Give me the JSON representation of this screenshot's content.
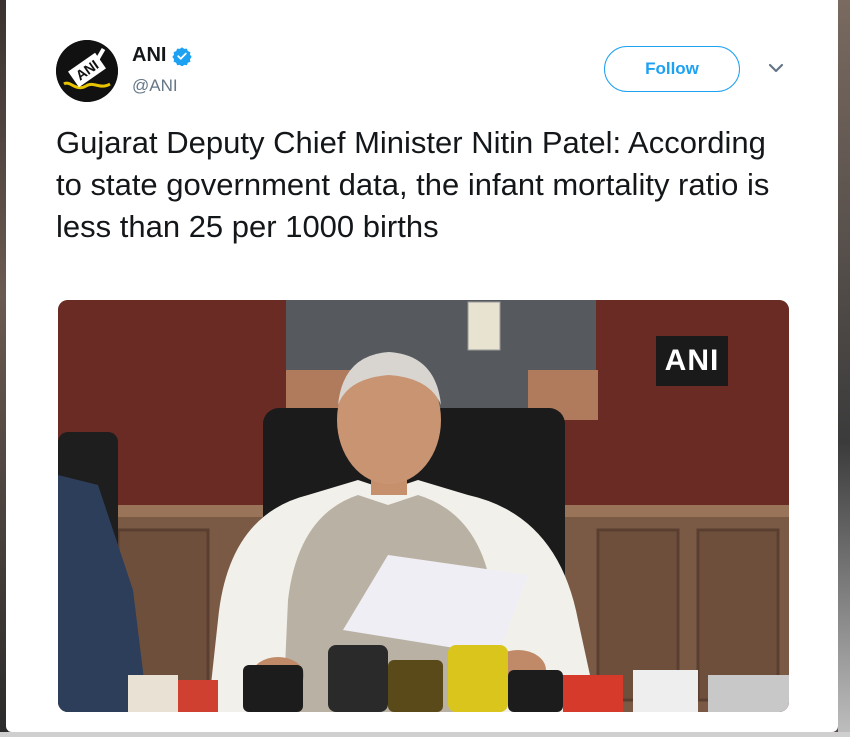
{
  "tweet": {
    "author_name": "ANI",
    "author_handle": "@ANI",
    "verified": true,
    "follow_label": "Follow",
    "text": "Gujarat Deputy Chief Minister Nitin Patel: According to state government data, the infant mortality ratio is less than 25 per 1000 births",
    "media_watermark": "ANI",
    "avatar_text": "ANI"
  },
  "icons": {
    "verified": "verified-badge-icon",
    "more": "chevron-down-icon"
  },
  "colors": {
    "accent": "#1da1f2",
    "text": "#14171a",
    "muted": "#657786"
  }
}
